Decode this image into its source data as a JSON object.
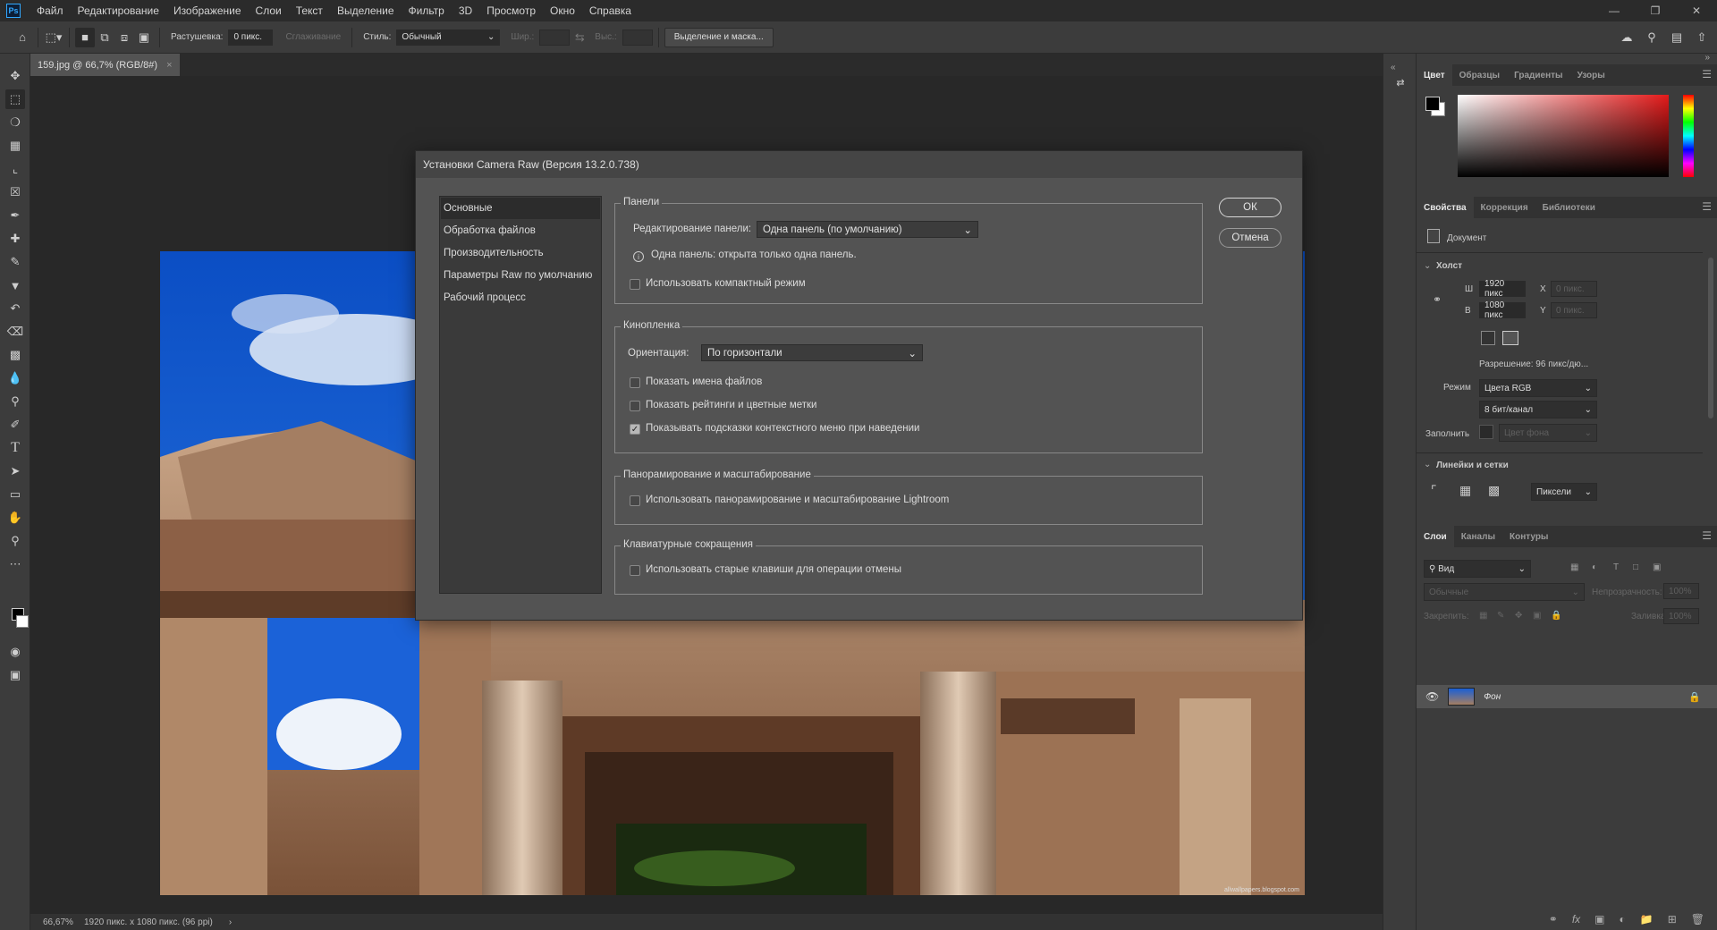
{
  "menubar": {
    "logo": "Ps",
    "items": [
      "Файл",
      "Редактирование",
      "Изображение",
      "Слои",
      "Текст",
      "Выделение",
      "Фильтр",
      "3D",
      "Просмотр",
      "Окно",
      "Справка"
    ]
  },
  "options": {
    "feather_label": "Растушевка:",
    "feather_value": "0 пикс.",
    "antialias_label": "Сглаживание",
    "style_label": "Стиль:",
    "style_value": "Обычный",
    "width_label": "Шир.:",
    "height_label": "Выс.:",
    "select_mask_button": "Выделение и маска..."
  },
  "document": {
    "tab_title": "159.jpg @ 66,7% (RGB/8#)",
    "zoom": "66,67%",
    "info": "1920 пикс. x 1080 пикс. (96 ppi)",
    "watermark": "allwallpapers.blogspot.com"
  },
  "dialog": {
    "title": "Установки Camera Raw  (Версия 13.2.0.738)",
    "nav": [
      "Основные",
      "Обработка файлов",
      "Производительность",
      "Параметры Raw по умолчанию",
      "Рабочий процесс"
    ],
    "panels": {
      "title": "Панели",
      "edit_label": "Редактирование панели:",
      "edit_value": "Одна панель (по умолчанию)",
      "info": "Одна панель: открыта только одна панель.",
      "compact": "Использовать компактный режим"
    },
    "filmstrip": {
      "title": "Кинопленка",
      "orientation_label": "Ориентация:",
      "orientation_value": "По горизонтали",
      "show_names": "Показать имена файлов",
      "show_ratings": "Показать рейтинги и цветные метки",
      "show_hints": "Показывать подсказки контекстного меню при наведении"
    },
    "pan": {
      "title": "Панорамирование и масштабирование",
      "use_lightroom": "Использовать панорамирование и масштабирование Lightroom"
    },
    "keys": {
      "title": "Клавиатурные сокращения",
      "legacy_undo": "Использовать старые клавиши для операции отмены"
    },
    "ok": "ОК",
    "cancel": "Отмена"
  },
  "color_panel": {
    "tabs": [
      "Цвет",
      "Образцы",
      "Градиенты",
      "Узоры"
    ]
  },
  "properties_panel": {
    "tabs": [
      "Свойства",
      "Коррекция",
      "Библиотеки"
    ],
    "document_label": "Документ",
    "canvas_section": "Холст",
    "w_label": "Ш",
    "w_value": "1920 пикс",
    "h_label": "В",
    "h_value": "1080 пикс",
    "x_label": "X",
    "x_placeholder": "0 пикс.",
    "y_label": "Y",
    "y_placeholder": "0 пикс.",
    "resolution": "Разрешение: 96 пикс/дю...",
    "mode_label": "Режим",
    "mode_value": "Цвета RGB",
    "depth_value": "8 бит/канал",
    "fill_label": "Заполнить",
    "fill_value": "Цвет фона",
    "rulers_section": "Линейки и сетки",
    "units_value": "Пиксели"
  },
  "layers_panel": {
    "tabs": [
      "Слои",
      "Каналы",
      "Контуры"
    ],
    "search_placeholder": "Вид",
    "blend_mode": "Обычные",
    "opacity_label": "Непрозрачность:",
    "opacity_value": "100%",
    "lock_label": "Закрепить:",
    "fill_label": "Заливка:",
    "fill_value": "100%",
    "layer_name": "Фон"
  }
}
